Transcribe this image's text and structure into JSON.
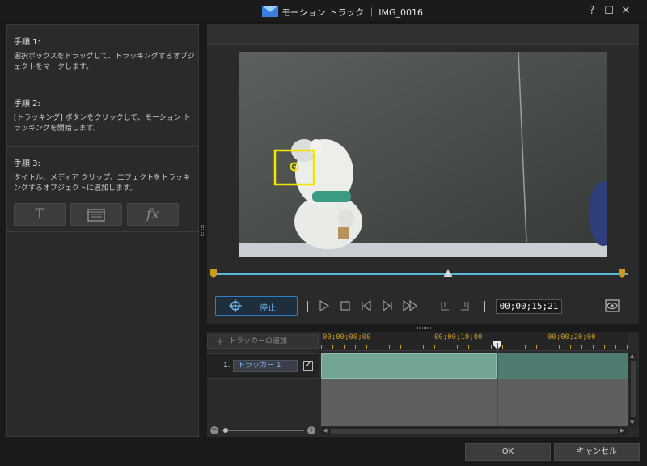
{
  "window": {
    "title": "モーション トラック ｜ IMG_0016",
    "help_label": "?",
    "maximize_label": "☐",
    "close_label": "✕"
  },
  "steps": [
    {
      "title": "手順 1:",
      "desc": "選択ボックスをドラッグして、トラッキングするオブジェクトをマークします。"
    },
    {
      "title": "手順 2:",
      "desc": "[トラッキング] ボタンをクリックして、モーション トラッキングを開始します。"
    },
    {
      "title": "手順 3:",
      "desc": "タイトル、メディア クリップ、エフェクトをトラッキングするオブジェクトに追加します。"
    }
  ],
  "step3_buttons": [
    {
      "name": "title",
      "icon": "T"
    },
    {
      "name": "media-clip",
      "icon": "film"
    },
    {
      "name": "effect",
      "icon": "fx"
    }
  ],
  "controls": {
    "stop_label": "停止",
    "timecode": "00;00;15;21"
  },
  "timeline": {
    "add_tracker_label": "トラッカーの追加",
    "ruler_labels": [
      "00;00;00;00",
      "00;00;10;00",
      "00;00;20;00"
    ],
    "track_number": "1.",
    "track_name": "トラッカー 1",
    "track_checked": "✓"
  },
  "dialog": {
    "ok_label": "OK",
    "cancel_label": "キャンセル"
  },
  "colors": {
    "accent": "#2f7fc5",
    "tracking_box": "#f1e400",
    "playhead": "#dd1111",
    "clip": "#73a597"
  }
}
